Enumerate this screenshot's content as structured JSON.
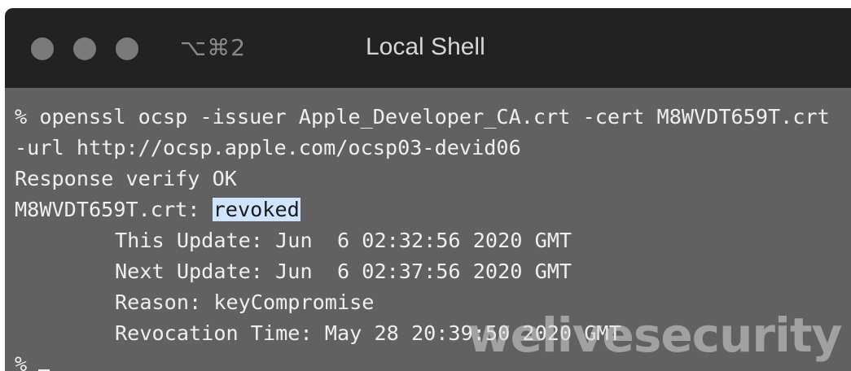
{
  "window": {
    "shortcut": "⌥⌘2",
    "title": "Local Shell",
    "traffic_light_color": "#7a7a7a"
  },
  "terminal": {
    "lines": [
      "% openssl ocsp -issuer Apple_Developer_CA.crt -cert M8WVDT659T.crt",
      "-url http://ocsp.apple.com/ocsp03-devid06",
      "Response verify OK"
    ],
    "status_prefix": "M8WVDT659T.crt: ",
    "status_value": "revoked",
    "details": [
      "This Update: Jun  6 02:32:56 2020 GMT",
      "Next Update: Jun  6 02:37:56 2020 GMT",
      "Reason: keyCompromise",
      "Revocation Time: May 28 20:39:50 2020 GMT"
    ],
    "prompt": "%",
    "background": "#616161",
    "highlight_color": "#cfe5ff"
  },
  "watermark": "welivesecurity"
}
